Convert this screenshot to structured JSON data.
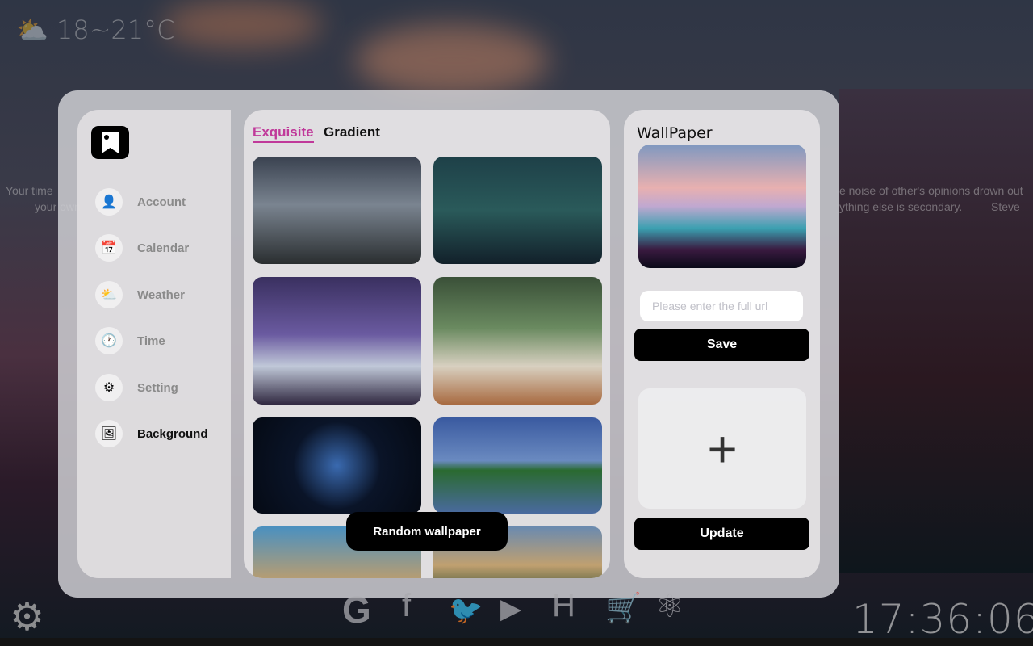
{
  "weather": {
    "icon": "partly-cloudy-icon",
    "temp_range": "18~21°C"
  },
  "quote": {
    "left_line1": "Your time",
    "left_line2": "your own",
    "right_line1": "e noise of other's opinions drown out",
    "right_line2": "ything else is secondary. —— Steve"
  },
  "sidebar": {
    "items": [
      {
        "label": "Account",
        "icon": "account-icon",
        "glyph": "👤"
      },
      {
        "label": "Calendar",
        "icon": "calendar-icon",
        "glyph": "📅"
      },
      {
        "label": "Weather",
        "icon": "weather-icon",
        "glyph": "⛅"
      },
      {
        "label": "Time",
        "icon": "clock-icon",
        "glyph": "🕐"
      },
      {
        "label": "Setting",
        "icon": "sliders-icon",
        "glyph": "⚙"
      },
      {
        "label": "Background",
        "icon": "image-icon",
        "glyph": "🖼",
        "active": true
      }
    ]
  },
  "tabs": [
    {
      "label": "Exquisite",
      "active": true
    },
    {
      "label": "Gradient"
    }
  ],
  "accent_color": "#c0399a",
  "random_wallpaper_label": "Random wallpaper",
  "wallpaper_panel": {
    "title": "WallPaper",
    "url_placeholder": "Please enter the full url",
    "save_label": "Save",
    "upload_glyph": "+",
    "update_label": "Update"
  },
  "dock": {
    "icons": [
      "google-icon",
      "facebook-icon",
      "twitter-icon",
      "youtube-icon",
      "hackernews-icon",
      "cart-icon",
      "atom-icon"
    ]
  },
  "clock": "17:36:06"
}
